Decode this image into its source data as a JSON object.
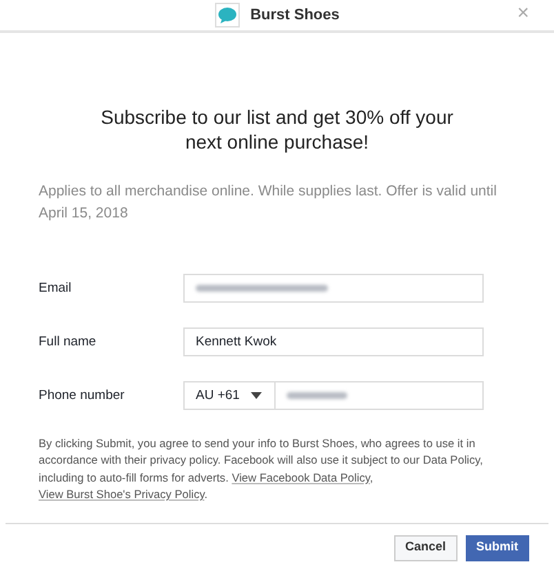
{
  "header": {
    "title": "Burst Shoes",
    "close": "×"
  },
  "heading": "Subscribe to our list and get 30% off your next online purchase!",
  "subtext": "Applies to all merchandise online. While supplies last. Offer is valid until April 15, 2018",
  "fields": [
    {
      "kind": "text",
      "label": "Email",
      "redacted": true
    },
    {
      "kind": "text",
      "label": "Full name",
      "value": "Kennett Kwok",
      "redacted": false
    },
    {
      "kind": "phone",
      "label": "Phone number",
      "country": "AU +61",
      "redacted": true
    }
  ],
  "legal": [
    {
      "kind": "text",
      "text": "By clicking Submit, you agree to send your info to Burst Shoes, who agrees to use it in accordance with their privacy policy. Facebook will also use it subject to our Data Policy, including to auto-fill forms for adverts. "
    },
    {
      "kind": "link",
      "text": "View Facebook Data Policy"
    },
    {
      "kind": "text",
      "text": ", "
    },
    {
      "kind": "link",
      "text": "View Burst Shoe's Privacy Policy"
    },
    {
      "kind": "text",
      "text": "."
    }
  ],
  "buttons": [
    {
      "label": "Cancel",
      "primary": false
    },
    {
      "label": "Submit",
      "primary": true
    }
  ]
}
